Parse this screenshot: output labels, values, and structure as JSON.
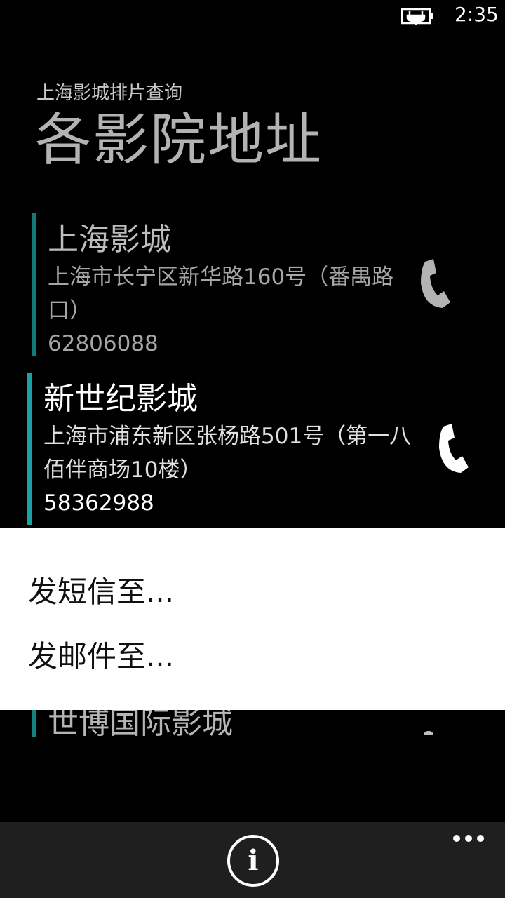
{
  "status": {
    "time": "2:35",
    "battery_icon": "battery-charging-icon"
  },
  "header": {
    "app_title": "上海影城排片查询",
    "page_title": "各影院地址"
  },
  "cinemas": [
    {
      "name": "上海影城",
      "address": "上海市长宁区新华路160号（番禺路口）",
      "phone": "62806088"
    },
    {
      "name": "新世纪影城",
      "address": "上海市浦东新区张杨路501号（第一八佰伴商场10楼）",
      "phone": "58362988"
    },
    {
      "name": "世博国际影城"
    }
  ],
  "context_menu": {
    "items": [
      "发短信至...",
      "发邮件至..."
    ]
  },
  "app_bar": {
    "info_label": "i",
    "more_icon": "ellipsis-icon"
  },
  "colors": {
    "accent": "#1ba1a1",
    "background": "#000000",
    "menu_background": "#ffffff",
    "app_bar": "#1f1f1f"
  }
}
